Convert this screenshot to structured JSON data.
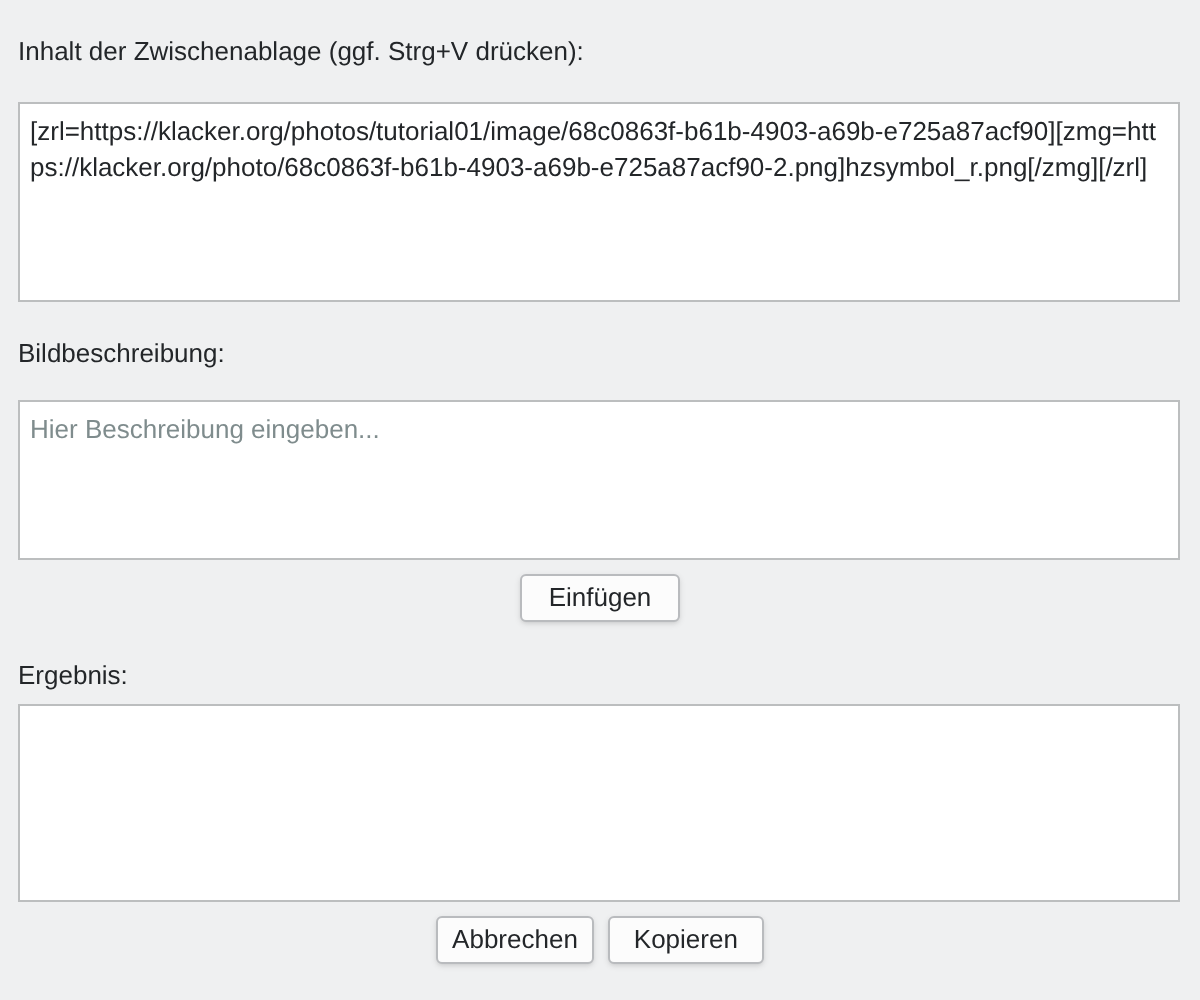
{
  "clipboard": {
    "label": "Inhalt der Zwischenablage (ggf. Strg+V drücken):",
    "value": "[zrl=https://klacker.org/photos/tutorial01/image/68c0863f-b61b-4903-a69b-e725a87acf90][zmg=https://klacker.org/photo/68c0863f-b61b-4903-a69b-e725a87acf90-2.png]hzsymbol_r.png[/zmg][/zrl]"
  },
  "description": {
    "label": "Bildbeschreibung:",
    "placeholder": "Hier Beschreibung eingeben..."
  },
  "insert_button": "Einfügen",
  "result": {
    "label": "Ergebnis:"
  },
  "buttons": [
    "Abbrechen",
    "Kopieren"
  ]
}
